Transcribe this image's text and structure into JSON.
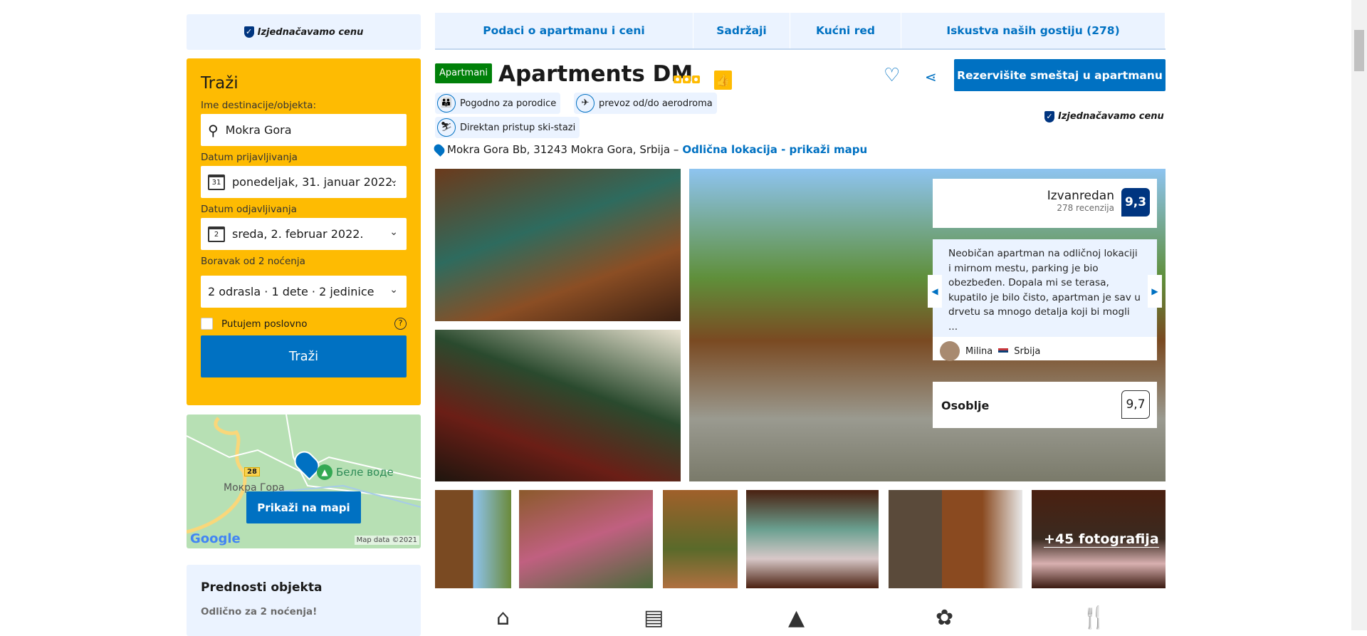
{
  "price_match": "Izjednačavamo cenu",
  "search": {
    "title": "Traži",
    "destination_label": "Ime destinacije/objekta:",
    "destination_value": "Mokra Gora",
    "checkin_label": "Datum prijavljivanja",
    "checkin_day": "31",
    "checkin_value": "ponedeljak, 31. januar 2022.",
    "checkout_label": "Datum odjavljivanja",
    "checkout_day": "2",
    "checkout_value": "sreda, 2. februar 2022.",
    "stay_label": "Boravak od 2 noćenja",
    "guests_value": "2 odrasla · 1 dete · 2 jedinice",
    "business_label": "Putujem poslovno",
    "button": "Traži"
  },
  "map": {
    "place1": "Мокра Гора",
    "place2": "Беле воде",
    "road": "28",
    "button": "Prikaži na mapi",
    "logo": "Google",
    "credit": "Map data ©2021"
  },
  "benefits": {
    "title": "Prednosti objekta",
    "item": "Odlično za 2 noćenja!"
  },
  "tabs": [
    {
      "label": "Podaci o apartmanu i ceni"
    },
    {
      "label": "Sadržaji"
    },
    {
      "label": "Kućni red"
    },
    {
      "label": "Iskustva naših gostiju (278)"
    }
  ],
  "property": {
    "type_badge": "Apartmani",
    "name": "Apartments DM",
    "reserve_button": "Rezervišite smeštaj u apartmanu",
    "price_match": "Izjednačavamo cenu",
    "highlights": [
      {
        "label": "Pogodno za porodice"
      },
      {
        "label": "prevoz od/do aerodroma"
      },
      {
        "label": "Direktan pristup ski-stazi"
      }
    ],
    "address": "Mokra Gora Bb, 31243 Mokra Gora, Srbija –",
    "map_link": "Odlična lokacija - prikaži mapu"
  },
  "rating": {
    "label": "Izvanredan",
    "reviews": "278 recenzija",
    "score": "9,3"
  },
  "review": {
    "text": "Neobičan apartman na odličnoj lokaciji i mirnom mestu, parking je bio obezbeđen. Dopala mi se terasa, kupatilo je bilo čisto, apartman je sav u drvetu sa mnogo detalja koji bi mogli ...",
    "author": "Milina",
    "country": "Srbija"
  },
  "staff": {
    "label": "Osoblje",
    "score": "9,7"
  },
  "more_photos": "+45 fotografija",
  "colors": {
    "brand_blue": "#0071c2",
    "yellow": "#febb02",
    "dark_blue": "#003580",
    "green": "#008009"
  }
}
